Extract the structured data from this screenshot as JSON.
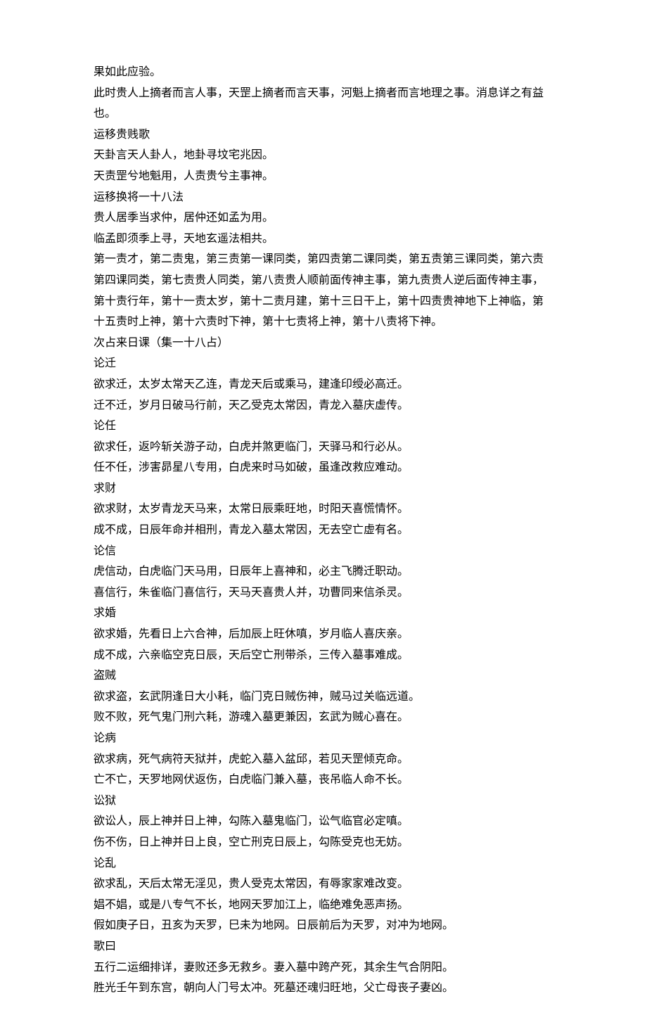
{
  "lines": [
    "果如此应验。",
    "此时贵人上摘者而言人事，天罡上摘者而言天事，河魁上摘者而言地理之事。消息详之有益也。",
    "运移贵贱歌",
    "天卦言天人卦人，地卦寻坟宅兆因。",
    "天责罡兮地魁用，人责贵兮主事神。",
    "运移换将一十八法",
    "贵人居季当求仲，居仲还如孟为用。",
    "临孟即须季上寻，天地玄遥法相共。",
    "第一责才，第二责鬼，第三责第一课同类，第四责第二课同类，第五责第三课同类，第六责第四课同类，第七责贵人同类，第八责贵人顺前面传神主事，第九责贵人逆后面传神主事，第十责行年，第十一责太岁，第十二责月建，第十三日干上，第十四责贵神地下上神临，第十五责时上神，第十六责时下神，第十七责将上神，第十八责将下神。",
    "次占来日课（集一十八占）",
    "论迁",
    "欲求迁，太岁太常天乙连，青龙天后或乘马，建逢印绶必高迁。",
    "迁不迁，岁月日破马行前，天乙受克太常因，青龙入墓庆虚传。",
    "论任",
    "欲求任，返吟斩关游子动，白虎并煞更临门，天驿马和行必从。",
    "任不任，涉害昴星八专用，白虎来时马如破，虽逢改救应难动。",
    "求财",
    "欲求财，太岁青龙天马来，太常日辰乘旺地，时阳天喜慌情怀。",
    "成不成，日辰年命并相刑，青龙入墓太常因，无去空亡虚有名。",
    "论信",
    "虎信动，白虎临门天马用，日辰年上喜神和，必主飞腾迁职动。",
    "喜信行，朱雀临门喜信行，天马天喜贵人并，功曹同来信杀灵。",
    "求婚",
    "欲求婚，先看日上六合神，后加辰上旺休嗔，岁月临人喜庆亲。",
    "成不成，六亲临空克日辰，天后空亡刑带杀，三传入墓事难成。",
    "盗贼",
    "欲求盗，玄武阴逢日大小耗，临门克日贼伤神，贼马过关临远道。",
    "败不败，死气鬼门刑六耗，游魂入墓更兼因，玄武为贼心喜在。",
    "论病",
    "欲求病，死气病符天狱并，虎蛇入墓入盆邱，若见天罡倾克命。",
    "亡不亡，天罗地网伏返伤，白虎临门兼入墓，丧吊临人命不长。",
    "讼狱",
    "欲讼人，辰上神并日上神，勾陈入墓鬼临门，讼气临官必定嗔。",
    "伤不伤，日上神并日上良，空亡刑克日辰上，勾陈受克也无妨。",
    "论乱",
    "欲求乱，天后太常无淫见，贵人受克太常因，有辱家家难改变。",
    "娼不娼，或是八专气不长，地网天罗加江上，临绝难免恶声扬。",
    "假如庚子日，丑亥为天罗，巳未为地网。日辰前后为天罗，对冲为地网。",
    "歌曰",
    "五行二运细排详，妻败还多无救乡。妻入墓中跨产死，其余生气合阴阳。",
    "胜光壬午到东宫，朝向人门号太冲。死墓还魂归旺地，父亡母丧子妻凶。"
  ]
}
